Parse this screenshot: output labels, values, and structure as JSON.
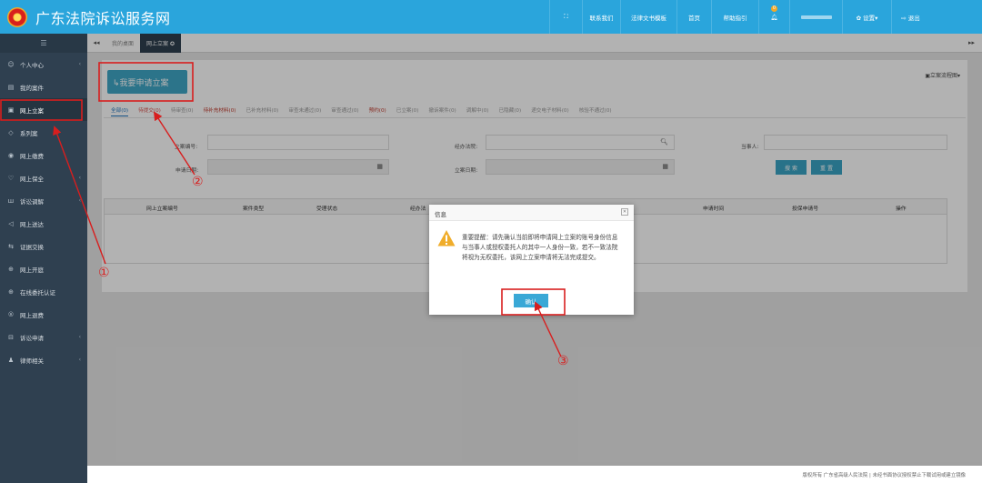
{
  "header": {
    "title": "广东法院诉讼服务网",
    "nav": [
      {
        "label": "",
        "icon": "expand-icon"
      },
      {
        "label": "联系我们"
      },
      {
        "label": "法律文书模板"
      },
      {
        "label": "首页"
      },
      {
        "label": "帮助指引"
      },
      {
        "label": "",
        "icon": "bell-icon",
        "badge": "0"
      },
      {
        "label": "",
        "icon": "user-icon"
      },
      {
        "label": "✿ 设置▾"
      },
      {
        "label": "⇨ 退出"
      }
    ]
  },
  "sidebar": {
    "toggle": "☰",
    "items": [
      {
        "icon": "☺",
        "label": "个人中心",
        "arrow": true
      },
      {
        "icon": "▤",
        "label": "我的案件",
        "arrow": false
      },
      {
        "icon": "▣",
        "label": "网上立案",
        "arrow": false
      },
      {
        "icon": "◇",
        "label": "系列案",
        "arrow": false
      },
      {
        "icon": "◉",
        "label": "网上缴费",
        "arrow": false
      },
      {
        "icon": "♡",
        "label": "网上保全",
        "arrow": true
      },
      {
        "icon": "ш",
        "label": "诉讼调解",
        "arrow": true
      },
      {
        "icon": "◁",
        "label": "网上送达",
        "arrow": false
      },
      {
        "icon": "⇆",
        "label": "证据交换",
        "arrow": false
      },
      {
        "icon": "⊕",
        "label": "网上开庭",
        "arrow": false
      },
      {
        "icon": "⊕",
        "label": "在线委托认证",
        "arrow": false
      },
      {
        "icon": "®",
        "label": "网上退费",
        "arrow": false
      },
      {
        "icon": "⊟",
        "label": "诉讼申请",
        "arrow": true
      },
      {
        "icon": "♟",
        "label": "律师相关",
        "arrow": true
      }
    ]
  },
  "tabs": {
    "back": "◂◂",
    "items": [
      "我的桌面",
      "网上立案 ✪"
    ],
    "forward": "▸▸"
  },
  "main": {
    "apply_button": "↳我要申请立案",
    "flow_link": "▣立案流程图▾",
    "status_tabs": [
      "全部(0)",
      "待提交(0)",
      "待审查(0)",
      "待补充材料(0)",
      "已补充材料(0)",
      "审查未通过(0)",
      "审查通过(0)",
      "预约(0)",
      "已立案(0)",
      "撤诉案件(0)",
      "调解中(0)",
      "已隐藏(0)",
      "递交电子材料(0)",
      "核验不通过(0)"
    ],
    "form": {
      "case_no_label": "立案编号:",
      "court_label": "经办法院:",
      "party_label": "当事人:",
      "apply_date_label": "申请日期:",
      "file_date_label": "立案日期:",
      "search_button": "搜 索",
      "reset_button": "重 置"
    },
    "table_headers": [
      "网上立案编号",
      "案件类型",
      "受理状态",
      "经办法",
      "",
      "申请时间",
      "投保申请号",
      "操作"
    ]
  },
  "dialog": {
    "title": "信息",
    "close": "✕",
    "message": "重要提醒：请先确认当前即将申请网上立案的账号身份信息与当事人或授权委托人的其中一人身份一致，若不一致法院将视为无权委托，该网上立案申请将无法完成提交。",
    "ok_button": "确认"
  },
  "annotations": [
    "①",
    "②",
    "③"
  ],
  "footer": "版权所有 广东省高级人民法院 | 未经书面协议授权禁止下载试用或建立镜像",
  "colors": {
    "header_bg": "#2aa5dc",
    "sidebar_bg": "#2f4050",
    "accent_button": "#3fa6c6",
    "annotation_red": "#d81e1e"
  }
}
